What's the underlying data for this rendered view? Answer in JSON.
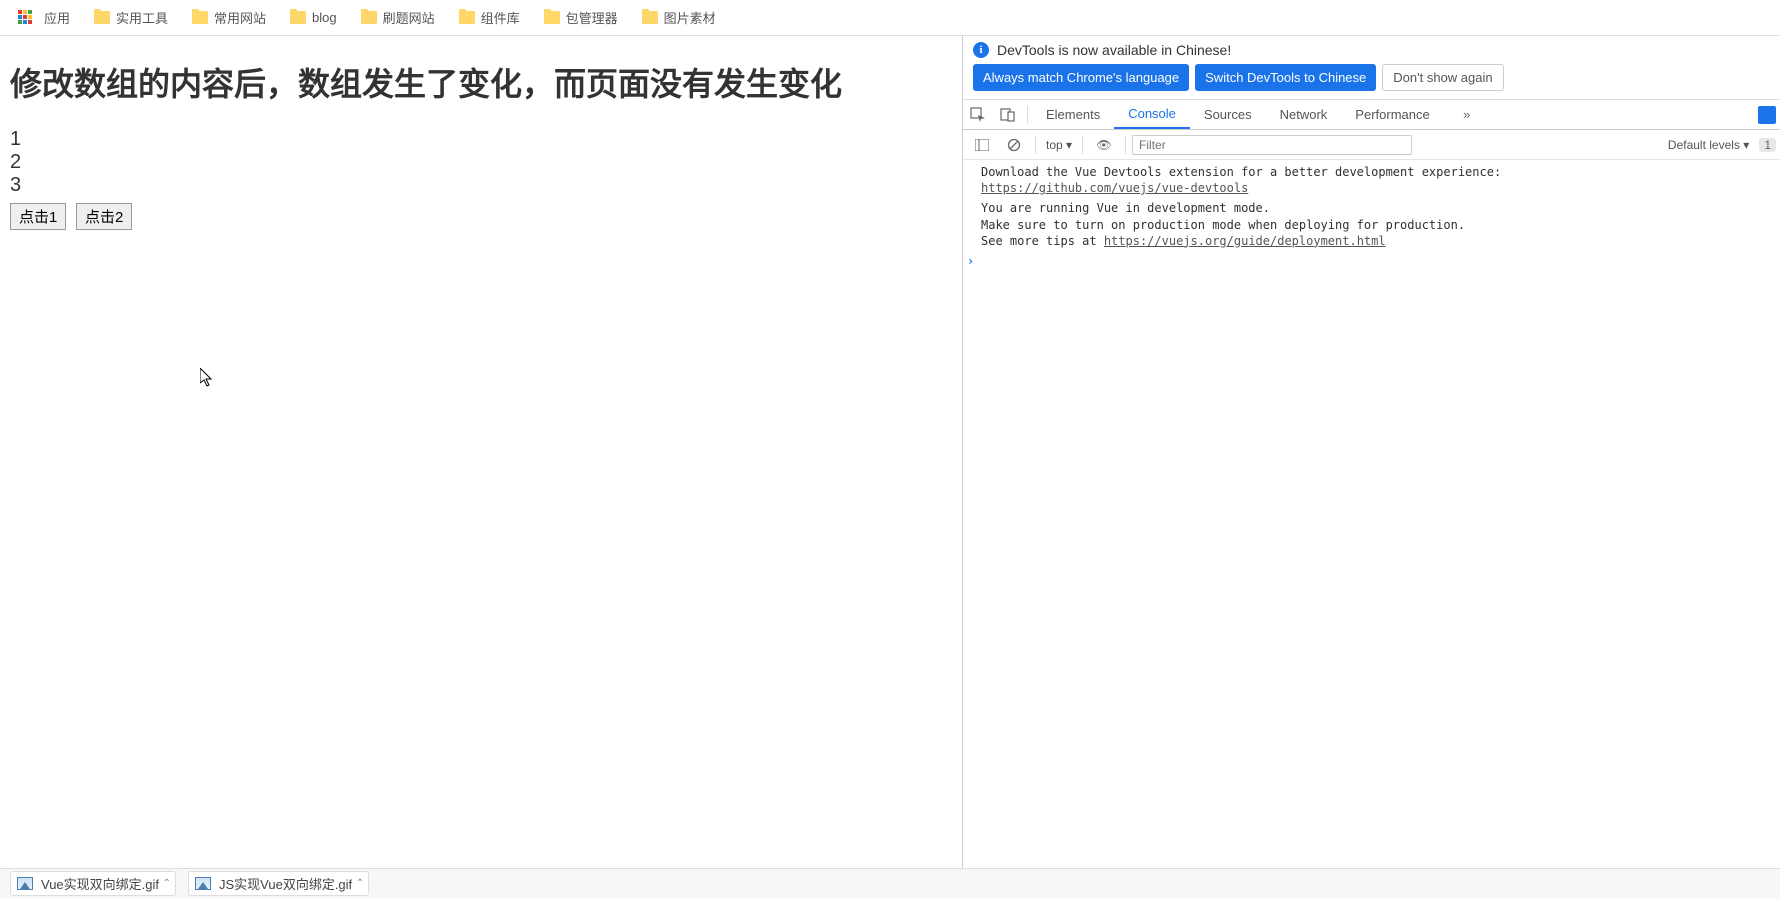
{
  "bookmarks": {
    "apps_label": "应用",
    "items": [
      "实用工具",
      "常用网站",
      "blog",
      "刷题网站",
      "组件库",
      "包管理器",
      "图片素材"
    ]
  },
  "page": {
    "heading": "修改数组的内容后，数组发生了变化，而页面没有发生变化",
    "list": [
      "1",
      "2",
      "3"
    ],
    "buttons": {
      "btn1": "点击1",
      "btn2": "点击2"
    }
  },
  "devtools": {
    "info_message": "DevTools is now available in Chinese!",
    "buttons": {
      "match": "Always match Chrome's language",
      "switch": "Switch DevTools to Chinese",
      "dont_show": "Don't show again"
    },
    "tabs": {
      "elements": "Elements",
      "console": "Console",
      "sources": "Sources",
      "network": "Network",
      "performance": "Performance"
    },
    "console_toolbar": {
      "context": "top ▾",
      "filter_placeholder": "Filter",
      "levels": "Default levels ▾",
      "issue_count": "1"
    },
    "console": {
      "msg1_line1": "Download the Vue Devtools extension for a better development experience:",
      "msg1_link": "https://github.com/vuejs/vue-devtools",
      "msg2_line1": "You are running Vue in development mode.",
      "msg2_line2": "Make sure to turn on production mode when deploying for production.",
      "msg2_line3_prefix": "See more tips at ",
      "msg2_link": "https://vuejs.org/guide/deployment.html"
    }
  },
  "downloads": {
    "item1": "Vue实现双向绑定.gif",
    "item2": "JS实现Vue双向绑定.gif"
  }
}
